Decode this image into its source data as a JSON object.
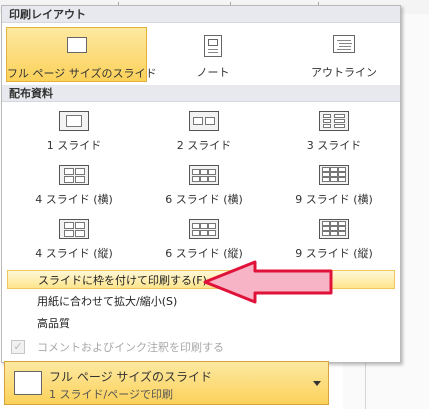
{
  "print_layout": {
    "header": "印刷レイアウト",
    "items": [
      {
        "label": "フル ページ サイズのスライド",
        "icon": "full-page-slide-icon",
        "selected": true
      },
      {
        "label": "ノート",
        "icon": "notes-page-icon",
        "selected": false
      },
      {
        "label": "アウトライン",
        "icon": "outline-icon",
        "selected": false
      }
    ]
  },
  "handouts": {
    "header": "配布資料",
    "items": [
      {
        "label": "1 スライド",
        "icon": "handout-1-slide-icon"
      },
      {
        "label": "2 スライド",
        "icon": "handout-2-slides-icon"
      },
      {
        "label": "3 スライド",
        "icon": "handout-3-slides-icon"
      },
      {
        "label": "4 スライド (横)",
        "icon": "handout-4-slides-horizontal-icon"
      },
      {
        "label": "6 スライド (横)",
        "icon": "handout-6-slides-horizontal-icon"
      },
      {
        "label": "9 スライド (横)",
        "icon": "handout-9-slides-horizontal-icon"
      },
      {
        "label": "4 スライド (縦)",
        "icon": "handout-4-slides-vertical-icon"
      },
      {
        "label": "6 スライド (縦)",
        "icon": "handout-6-slides-vertical-icon"
      },
      {
        "label": "9 スライド (縦)",
        "icon": "handout-9-slides-vertical-icon"
      }
    ]
  },
  "options": [
    {
      "label": "スライドに枠を付けて印刷する(F)",
      "highlighted": true,
      "disabled": false
    },
    {
      "label": "用紙に合わせて拡大/縮小(S)",
      "highlighted": false,
      "disabled": false
    },
    {
      "label": "高品質",
      "highlighted": false,
      "disabled": false
    },
    {
      "label": "コメントおよびインク注釈を印刷する",
      "highlighted": false,
      "disabled": true,
      "checked": true
    }
  ],
  "dropdown": {
    "title": "フル ページ サイズのスライド",
    "subtitle": "1 スライド/ページで印刷"
  },
  "colors": {
    "selected_bg": "#fbd15a",
    "arrow_fill": "#f7b4c6",
    "arrow_stroke": "#e0123a"
  }
}
